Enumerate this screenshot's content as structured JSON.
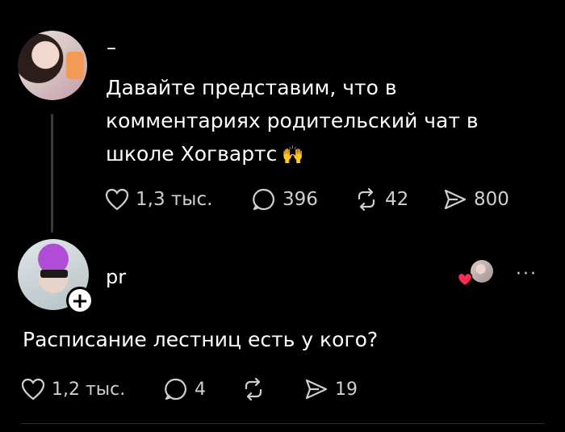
{
  "post1": {
    "author": "–",
    "text": "Давайте представим, что в\nкомментариях родительский чат в\nшколе Хогвартс",
    "emoji": "🙌",
    "likes": "1,3 тыс.",
    "comments": "396",
    "reposts": "42",
    "shares": "800"
  },
  "post2": {
    "author": "pr",
    "follow_symbol": "+",
    "more_symbol": "···",
    "text": "Расписание лестниц есть у кого?",
    "likes": "1,2 тыс.",
    "comments": "4",
    "shares": "19"
  },
  "colors": {
    "background": "#000000",
    "text": "#ffffff",
    "muted": "#cfcfcf",
    "heart_badge": "#ff2d4f"
  }
}
